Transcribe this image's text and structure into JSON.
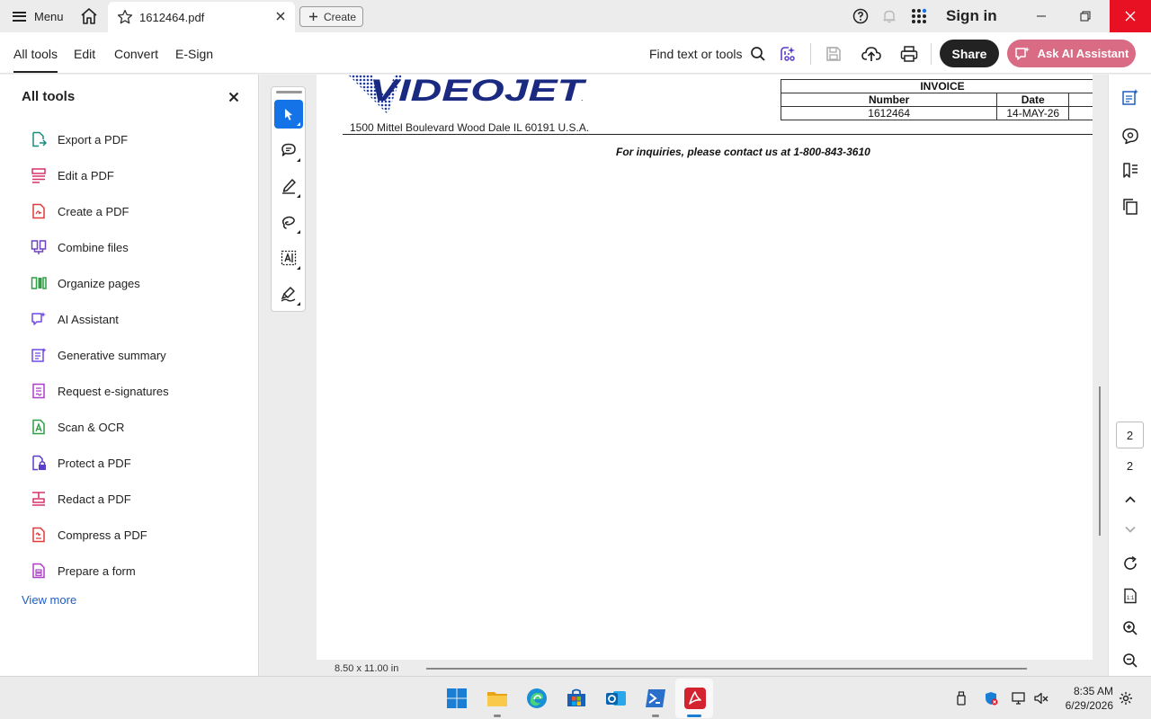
{
  "titlebar": {
    "menu_label": "Menu",
    "tab_title": "1612464.pdf",
    "create_label": "Create",
    "signin_label": "Sign in"
  },
  "toolbar": {
    "tabs": [
      "All tools",
      "Edit",
      "Convert",
      "E-Sign"
    ],
    "active_tab": "All tools",
    "find_label": "Find text or tools",
    "share_label": "Share",
    "ai_label": "Ask AI Assistant",
    "ai_color": "#d96b84"
  },
  "left_panel": {
    "title": "All tools",
    "items": [
      {
        "label": "Export a PDF",
        "icon": "export-pdf-icon",
        "color": "#1a8a7a"
      },
      {
        "label": "Edit a PDF",
        "icon": "edit-pdf-icon",
        "color": "#d6336c"
      },
      {
        "label": "Create a PDF",
        "icon": "create-pdf-icon",
        "color": "#e03a3a"
      },
      {
        "label": "Combine files",
        "icon": "combine-files-icon",
        "color": "#6f42c1"
      },
      {
        "label": "Organize pages",
        "icon": "organize-pages-icon",
        "color": "#2f9e44"
      },
      {
        "label": "AI Assistant",
        "icon": "ai-assistant-icon",
        "color": "#7048e8"
      },
      {
        "label": "Generative summary",
        "icon": "generative-summary-icon",
        "color": "#7048e8"
      },
      {
        "label": "Request e-signatures",
        "icon": "request-esignatures-icon",
        "color": "#ae3ec9"
      },
      {
        "label": "Scan & OCR",
        "icon": "scan-ocr-icon",
        "color": "#2f9e44"
      },
      {
        "label": "Protect a PDF",
        "icon": "protect-pdf-icon",
        "color": "#5c3ec9"
      },
      {
        "label": "Redact a PDF",
        "icon": "redact-pdf-icon",
        "color": "#d6336c"
      },
      {
        "label": "Compress a PDF",
        "icon": "compress-pdf-icon",
        "color": "#e03a3a"
      },
      {
        "label": "Prepare a form",
        "icon": "prepare-form-icon",
        "color": "#ae3ec9"
      }
    ],
    "view_more": "View more"
  },
  "document": {
    "logo_text": "VIDEOJET",
    "address": "1500 Mittel Boulevard Wood Dale IL 60191 U.S.A.",
    "invoice": {
      "title": "INVOICE",
      "headers": [
        "Number",
        "Date"
      ],
      "values": [
        "1612464",
        "14-MAY-26"
      ]
    },
    "inquiry": "For inquiries, please contact us at 1-800-843-3610",
    "page_size": "8.50 x 11.00 in"
  },
  "right_rail": {
    "current_page": "2",
    "total_pages": "2"
  },
  "taskbar": {
    "time": "8:35 AM",
    "date": "6/29/2026"
  }
}
